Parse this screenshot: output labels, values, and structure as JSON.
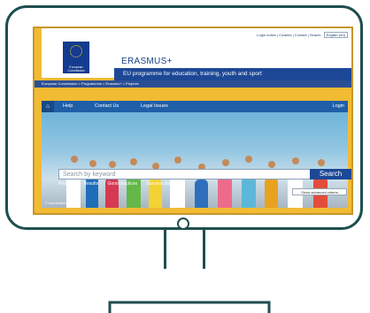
{
  "top_links": "Login notice | Cookies | Contact | Search",
  "language": "English (en)",
  "eu_label": "European Commission",
  "brand": "ERASMUS+",
  "tagline": "EU programme for education, training, youth and sport",
  "breadcrumb": "European Commission > Programmes > Erasmus+ > Projects",
  "nav": {
    "home_icon": "home-icon",
    "items": [
      "Help",
      "Contact Us",
      "Legal Issues"
    ],
    "login": "Login"
  },
  "search": {
    "placeholder": "Search by keyword",
    "button": "Search"
  },
  "filters": [
    "Projects",
    "Results",
    "Good practices",
    "Success stories"
  ],
  "advanced": "Show advanced criteria",
  "credit": "© www.shutterstock.com",
  "colors": {
    "accent": "#f2bb34",
    "brand_blue": "#1d4896",
    "frame": "#1f4e4f"
  }
}
